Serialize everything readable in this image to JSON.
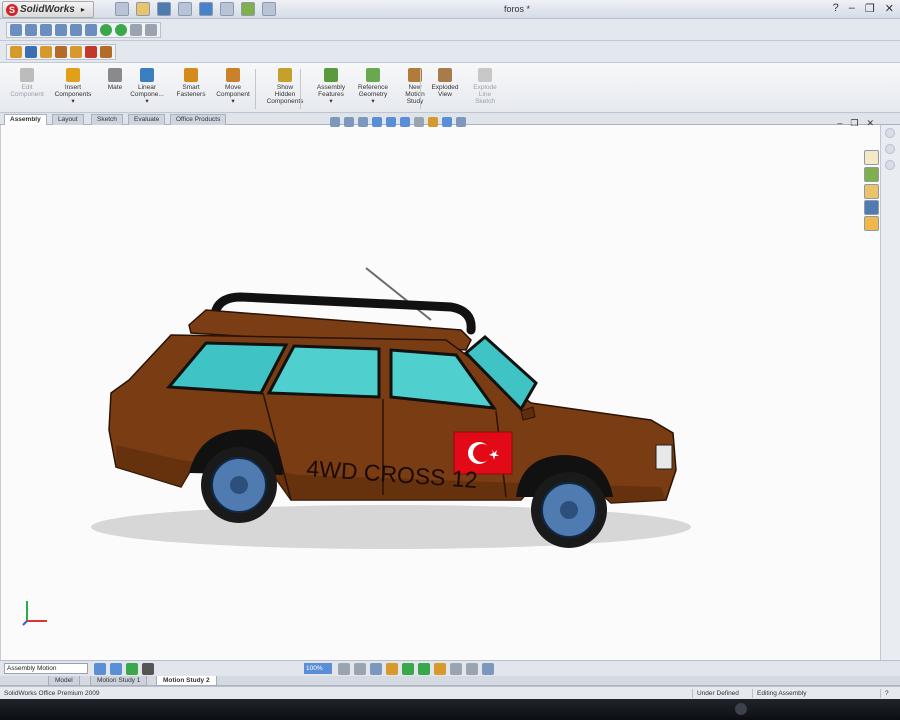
{
  "app": {
    "logo_text": "SolidWorks",
    "logo_letter": "S",
    "doc_title": "foros *"
  },
  "window_controls": {
    "help": "?",
    "minimize": "–",
    "restore": "❐",
    "close": "✕"
  },
  "command_manager": [
    {
      "label": "Edit\nComponent",
      "disabled": true,
      "color": "#bcbcbc"
    },
    {
      "label": "Insert\nComponents\n▾",
      "disabled": false,
      "color": "#e2a019"
    },
    {
      "label": "Mate",
      "disabled": false,
      "color": "#8a8a8a"
    },
    {
      "label": "Linear\nCompone...\n▾",
      "disabled": false,
      "color": "#3c7fc1"
    },
    {
      "label": "Smart\nFasteners",
      "disabled": false,
      "color": "#d58a1b"
    },
    {
      "label": "Move\nComponent\n▾",
      "disabled": false,
      "color": "#c9822a"
    },
    {
      "label": "Show\nHidden\nComponents",
      "disabled": false,
      "color": "#c5a12c"
    },
    {
      "label": "Assembly\nFeatures\n▾",
      "disabled": false,
      "color": "#5a9a3c"
    },
    {
      "label": "Reference\nGeometry\n▾",
      "disabled": false,
      "color": "#6aa84f"
    },
    {
      "label": "New\nMotion\nStudy",
      "disabled": false,
      "color": "#b07b3b"
    },
    {
      "label": "Exploded\nView",
      "disabled": false,
      "color": "#a77b4a"
    },
    {
      "label": "Explode\nLine\nSketch",
      "disabled": true,
      "color": "#c8c8c8"
    }
  ],
  "tabs": [
    "Assembly",
    "Layout",
    "Sketch",
    "Evaluate",
    "Office Products"
  ],
  "active_tab": "Assembly",
  "model": {
    "text": "4WD CROSS 12",
    "flag": "turkey",
    "colors": {
      "body": "#7a3d13",
      "glass": "#3fc3c4",
      "tire": "#1a1a1a",
      "rim": "#4f7bb0",
      "rack": "#101010",
      "flag_red": "#e30a17",
      "flag_white": "#ffffff"
    }
  },
  "axes_triad": {
    "x": "x",
    "y": "y"
  },
  "bottom_bar": {
    "assembly_select": "Assembly Motion",
    "zoom_value": "100%"
  },
  "bottom_tabs": [
    "Model",
    "Motion Study 1",
    "Motion Study 2"
  ],
  "active_bottom_tab": "Motion Study 2",
  "status": {
    "left": "SolidWorks Office Premium 2009",
    "under_defined": "Under Defined",
    "editing": "Editing Assembly",
    "help": "?"
  }
}
